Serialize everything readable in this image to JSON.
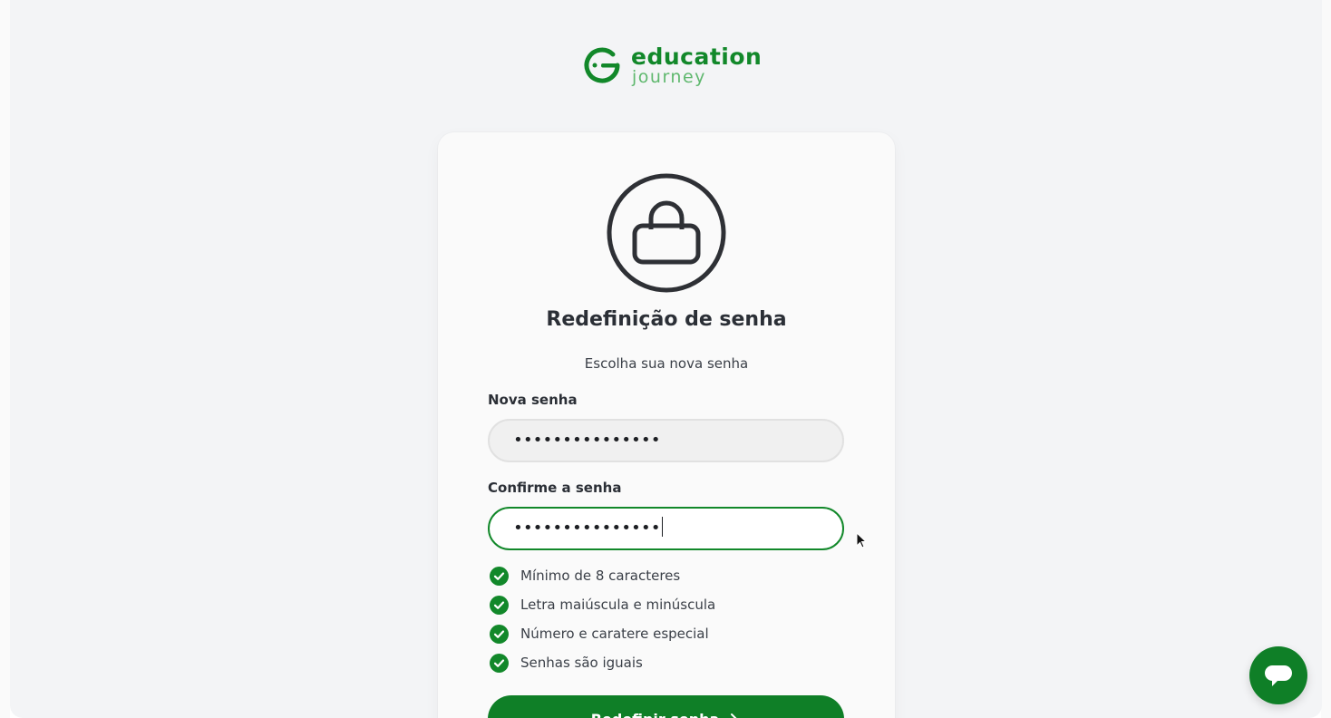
{
  "logo": {
    "word1": "education",
    "word2": "journey"
  },
  "card": {
    "title": "Redefinição de senha",
    "subtitle": "Escolha sua nova senha"
  },
  "form": {
    "new_password": {
      "label": "Nova senha",
      "value": "•••••••••••••••"
    },
    "confirm_password": {
      "label": "Confirme a senha",
      "value": "•••••••••••••••"
    },
    "requirements": [
      {
        "label": "Mínimo de 8 caracteres",
        "met": true
      },
      {
        "label": "Letra maiúscula e minúscula",
        "met": true
      },
      {
        "label": "Número e caratere especial",
        "met": true
      },
      {
        "label": "Senhas são iguais",
        "met": true
      }
    ],
    "submit_label": "Redefinir senha"
  },
  "icons": {
    "lock": "lock-icon",
    "check": "check-circle-icon",
    "arrow": "arrow-right-icon",
    "chat": "chat-bubble-icon",
    "cursor": "mouse-pointer-icon"
  },
  "colors": {
    "brand_green": "#12882a",
    "button_green": "#0f7f27",
    "text_dark": "#2b2f36",
    "page_bg": "#f3f4f6"
  }
}
